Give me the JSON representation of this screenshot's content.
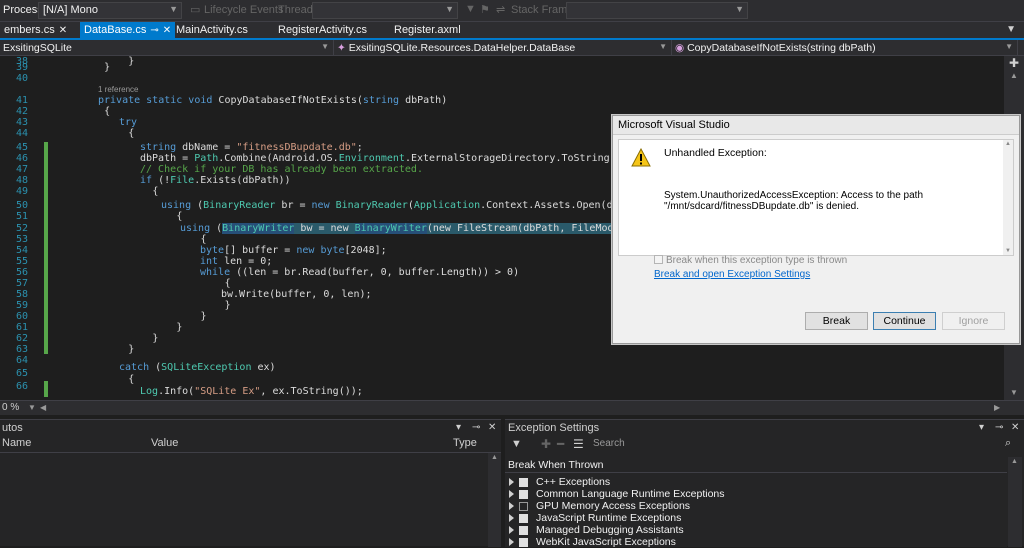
{
  "toolbar": {
    "process_label": "Process:",
    "process_value": "[N/A] Mono",
    "lifecycle_label": "Lifecycle Events",
    "thread_label": "Thread:",
    "stackframe_label": "Stack Frame:"
  },
  "tabs": [
    {
      "label": "embers.cs"
    },
    {
      "label": "DataBase.cs"
    },
    {
      "label": "MainActivity.cs"
    },
    {
      "label": "RegisterActivity.cs"
    },
    {
      "label": "Register.axml"
    }
  ],
  "navbar": {
    "project": "ExsitingSQLite",
    "class": "ExsitingSQLite.Resources.DataHelper.DataBase",
    "member": "CopyDatabaseIfNotExists(string dbPath)"
  },
  "editor": {
    "line_numbers": [
      "38",
      "39",
      "40",
      "41",
      "42",
      "43",
      "44",
      "45",
      "46",
      "47",
      "48",
      "49",
      "50",
      "51",
      "52",
      "53",
      "54",
      "55",
      "56",
      "57",
      "58",
      "59",
      "60",
      "61",
      "62",
      "63",
      "64",
      "65",
      "66"
    ],
    "reference_hint": "1 reference",
    "lines": {
      "l38": "            }",
      "l39": "        }",
      "l41a": "private static void ",
      "l41b": "CopyDatabaseIfNotExists(",
      "l41c": "string",
      "l41d": " dbPath)",
      "l42": "        {",
      "l43": "try",
      "l44": "            {",
      "l45a": "string",
      "l45b": " dbName = ",
      "l45c": "\"fitnessDBupdate.db\"",
      "l45d": ";",
      "l46a": "dbPath = ",
      "l46b": "Path",
      "l46c": ".Combine(Android.OS.",
      "l46d": "Environment",
      "l46e": ".ExternalStorageDirectory.ToString(), dbName);",
      "l47": "// Check if your DB has already been extracted.",
      "l48a": "if",
      "l48b": " (!",
      "l48c": "File",
      "l48d": ".Exists(dbPath))",
      "l49": "                {",
      "l50a": "using",
      "l50b": " (",
      "l50c": "BinaryReader",
      "l50d": " br = ",
      "l50e": "new ",
      "l50f": "BinaryReader",
      "l50g": "(",
      "l50h": "Application",
      "l50i": ".Context.Assets.Open(dbName)))",
      "l51": "                    {",
      "l52a": "using",
      "l52b": " (",
      "l52c": "BinaryWriter",
      "l52d": " bw = new ",
      "l52e": "BinaryWriter",
      "l52f": "(new FileStream(dbPath, FileMode.Create)))",
      "l53": "                        {",
      "l54a": "byte",
      "l54b": "[] buffer = ",
      "l54c": "new ",
      "l54d": "byte",
      "l54e": "[2048];",
      "l55a": "int",
      "l55b": " len = 0;",
      "l56a": "while",
      "l56b": " ((len = br.Read(buffer, 0, buffer.Length)) > 0)",
      "l57": "                            {",
      "l58": "bw.Write(buffer, 0, len);",
      "l59": "                            }",
      "l60": "                        }",
      "l61": "                    }",
      "l62": "                }",
      "l63": "            }",
      "l64a": "catch",
      "l64b": " (",
      "l64c": "SQLiteException",
      "l64d": " ex)",
      "l65": "            {",
      "l66a": "Log",
      "l66b": ".Info(",
      "l66c": "\"SQLite Ex\"",
      "l66d": ", ex.ToString());"
    }
  },
  "zoom": "0 %",
  "autos": {
    "title": "utos",
    "col_name": "Name",
    "col_value": "Value",
    "col_type": "Type"
  },
  "exception_settings": {
    "title": "Exception Settings",
    "search_placeholder": "Search",
    "header": "Break When Thrown",
    "items": [
      {
        "label": "C++ Exceptions",
        "checked": true
      },
      {
        "label": "Common Language Runtime Exceptions",
        "checked": true
      },
      {
        "label": "GPU Memory Access Exceptions",
        "checked": false
      },
      {
        "label": "JavaScript Runtime Exceptions",
        "checked": true
      },
      {
        "label": "Managed Debugging Assistants",
        "checked": true
      },
      {
        "label": "WebKit JavaScript Exceptions",
        "checked": true
      }
    ]
  },
  "dialog": {
    "title": "Microsoft Visual Studio",
    "heading": "Unhandled Exception:",
    "message_line1": "System.UnauthorizedAccessException: Access to the path",
    "message_line2": "\"/mnt/sdcard/fitnessDBupdate.db\" is denied.",
    "checkbox_label": "Break when this exception type is thrown",
    "link": "Break and open Exception Settings",
    "break_button": "Break",
    "continue_button": "Continue",
    "ignore_button": "Ignore"
  },
  "colors": {
    "accent": "#007acc",
    "keyword": "#569cd6",
    "type": "#4ec9b0",
    "string": "#d69d85",
    "comment": "#57a64a"
  }
}
